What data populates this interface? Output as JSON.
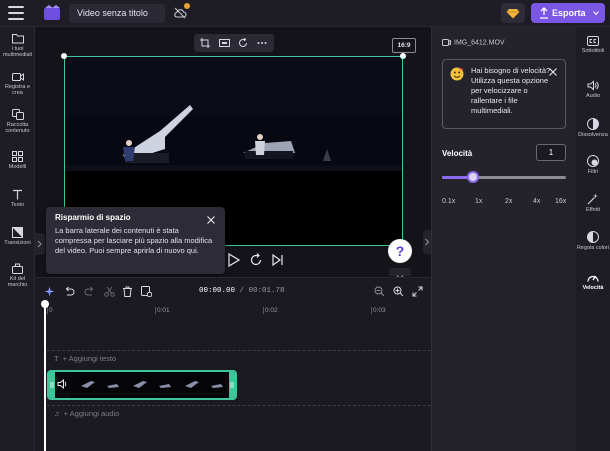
{
  "topbar": {
    "project_title": "Video senza titolo",
    "export_label": "Esporta"
  },
  "leftbar": {
    "items": [
      {
        "label": "I tuoi multimediali",
        "icon": "folder-icon"
      },
      {
        "label": "Registra e crea",
        "icon": "camera-icon"
      },
      {
        "label": "Raccolta contenuto",
        "icon": "library-icon"
      },
      {
        "label": "Modelli",
        "icon": "templates-icon"
      },
      {
        "label": "Testo",
        "icon": "text-icon"
      },
      {
        "label": "Transizioni",
        "icon": "transitions-icon"
      },
      {
        "label": "Kit del marchio",
        "icon": "brand-kit-icon"
      }
    ]
  },
  "preview": {
    "aspect_ratio": "16:9"
  },
  "tooltip": {
    "title": "Risparmio di spazio",
    "body": "La barra laterale dei contenuti è stata compressa per lasciare più spazio alla modifica del video. Puoi sempre aprirla di nuovo qui."
  },
  "help": {
    "label": "?"
  },
  "timeline": {
    "current_time": "00:00.00",
    "separator": " / ",
    "total_time": "00:01.78",
    "ruler_ticks": [
      "0",
      "0:01",
      "0:02",
      "0:03"
    ],
    "add_text_label": "+ Aggiungi testo",
    "add_audio_label": "+ Aggiungi audio"
  },
  "props": {
    "file_name": "IMG_6412.MOV",
    "speed_hint": "Hai bisogno di velocità? Utilizza questa opzione per velocizzare o rallentare i file multimediali.",
    "speed_label": "Velocità",
    "speed_value": "1",
    "speed_fraction": 0.25,
    "speed_ticks": [
      "0.1x",
      "1x",
      "2x",
      "4x",
      "16x"
    ]
  },
  "rightrail": {
    "items": [
      {
        "label": "Sottotitoli",
        "icon": "captions-icon"
      },
      {
        "label": "Audio",
        "icon": "audio-icon"
      },
      {
        "label": "Dissolvenza",
        "icon": "fade-icon"
      },
      {
        "label": "Filtri",
        "icon": "filters-icon"
      },
      {
        "label": "Effetti",
        "icon": "effects-icon"
      },
      {
        "label": "Regola colori",
        "icon": "adjust-colors-icon"
      },
      {
        "label": "Velocità",
        "icon": "speed-icon",
        "active": true
      }
    ]
  },
  "colors": {
    "accent": "#7b57e6",
    "selection": "#3fc59a",
    "panel": "#24232c",
    "background": "#1b1a22"
  }
}
